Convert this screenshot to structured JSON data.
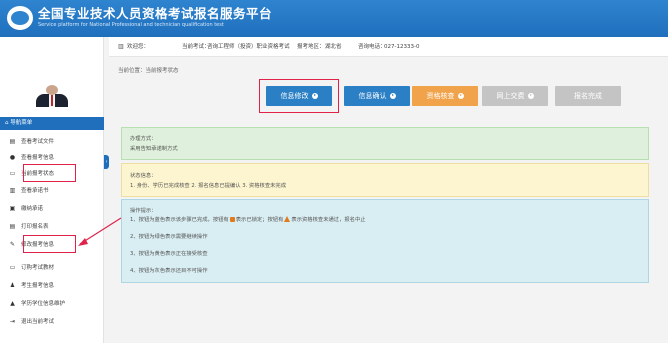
{
  "header": {
    "title": "全国专业技术人员资格考试报名服务平台",
    "subtitle": "Service platform for National Professional and technician qualification test"
  },
  "info_bar": {
    "welcome": "欢迎您：",
    "exam_label": "当前考试：",
    "exam_value": "咨询工程师（投资）职业资格考试",
    "region_label": "报考地区：",
    "region_value": "湖北省",
    "phone_label": "咨询电话：",
    "phone_value": "027-12333-0"
  },
  "breadcrumb": "当前位置：当前报考状态",
  "sidebar": {
    "nav_header": "导航菜单",
    "items": [
      {
        "icon": "document-icon",
        "glyph": "▤",
        "label": "查看考试文件"
      },
      {
        "icon": "info-icon",
        "glyph": "●",
        "label": "查看报考信息"
      },
      {
        "icon": "monitor-icon",
        "glyph": "▭",
        "label": "当前报考状态"
      },
      {
        "icon": "book-icon",
        "glyph": "▥",
        "label": "查看承诺书"
      },
      {
        "icon": "print-icon",
        "glyph": "▣",
        "label": "缴纳承诺"
      },
      {
        "icon": "printer-icon",
        "glyph": "▤",
        "label": "打印报名表"
      },
      {
        "icon": "edit-icon",
        "glyph": "✎",
        "label": "修改报考信息"
      },
      {
        "icon": "order-icon",
        "glyph": "▭",
        "label": "订购考试教材"
      },
      {
        "icon": "student-icon",
        "glyph": "♟",
        "label": "考生报考信息"
      },
      {
        "icon": "graduation-icon",
        "glyph": "▲",
        "label": "学历学位信息维护"
      },
      {
        "icon": "exit-icon",
        "glyph": "⇥",
        "label": "退出当前考试"
      }
    ]
  },
  "steps": [
    {
      "label": "信息修改",
      "color": "#2a7fc5"
    },
    {
      "label": "信息确认",
      "color": "#2a7fc5"
    },
    {
      "label": "资格核查",
      "color": "#f0a34a"
    },
    {
      "label": "网上交费",
      "color": "#c4c4c4"
    },
    {
      "label": "报名完成",
      "color": "#c4c4c4"
    }
  ],
  "panels": {
    "method": {
      "title": "办理方式：",
      "text": "采用告知承诺制方式"
    },
    "status": {
      "title": "状态信息：",
      "text": "1. 身份、学历已完成核查 2. 报名信息已提编认 3. 资格核查未完成"
    },
    "steps_hint": {
      "title": "操作提示：",
      "line1_a": "1、按钮为蓝色表示该步骤已完成，按钮有",
      "line1_b": "表示已锁定；按钮有",
      "line1_c": "表示资格核查未通过，报名中止",
      "line2": "2、按钮为绿色表示需要继续操作",
      "line3": "3、按钮为黄色表示正在接受核查",
      "line4": "4、按钮为灰色表示还目不可操作"
    }
  },
  "colors": {
    "brand": "#1f6fbd",
    "highlight": "#e0224b"
  }
}
